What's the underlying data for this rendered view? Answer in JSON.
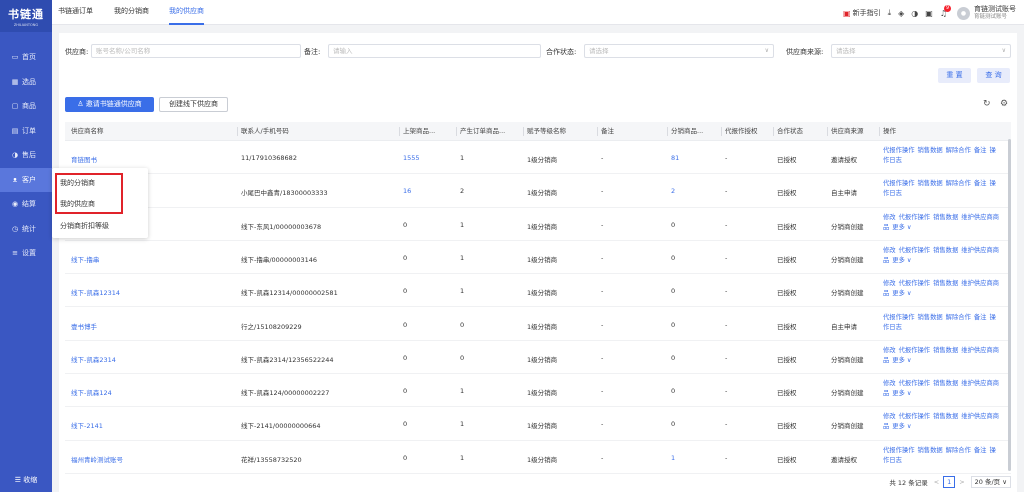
{
  "app": {
    "logo": "书链通",
    "logo_sub": "ZHILIANTONG"
  },
  "sidebar": {
    "items": [
      {
        "label": "首页",
        "icon": "monitor-icon",
        "glyph": "▭"
      },
      {
        "label": "选品",
        "icon": "grid-icon",
        "glyph": "▦"
      },
      {
        "label": "商品",
        "icon": "box-icon",
        "glyph": "▢"
      },
      {
        "label": "订单",
        "icon": "order-icon",
        "glyph": "▤"
      },
      {
        "label": "售后",
        "icon": "headset-icon",
        "glyph": "◑"
      },
      {
        "label": "客户",
        "icon": "users-icon",
        "glyph": "ᴥ"
      },
      {
        "label": "结算",
        "icon": "settle-icon",
        "glyph": "◉"
      },
      {
        "label": "统计",
        "icon": "clock-icon",
        "glyph": "◷"
      },
      {
        "label": "设置",
        "icon": "settings-icon",
        "glyph": "≡"
      }
    ],
    "collapse": "☰ 收缩"
  },
  "topnav": {
    "tabs": [
      "书链通订单",
      "我的分销商",
      "我的供应商"
    ],
    "guide": "新手指引",
    "user_name": "育链测试账号",
    "user_sub": "育链测试账号",
    "badge": "9"
  },
  "popup": {
    "items": [
      "我的分销商",
      "我的供应商",
      "分销商折扣等级"
    ]
  },
  "filters": {
    "supplier_label": "供应商:",
    "supplier_ph": "账号名称/公司名称",
    "remark_label": "备注:",
    "remark_ph": "请输入",
    "status_label": "合作状态:",
    "status_ph": "请选择",
    "source_label": "供应商来源:",
    "source_ph": "请选择",
    "reset": "重 置",
    "query": "查 询"
  },
  "actions": {
    "invite": "邀请书链通供应商",
    "create": "创建线下供应商"
  },
  "table": {
    "headers": [
      "供应商名称",
      "联系人/手机号码",
      "上架商品...",
      "产生订单商品...",
      "赋予等级名称",
      "备注",
      "分销商品...",
      "代报作授权",
      "合作状态",
      "供应商来源",
      "操作"
    ],
    "rows": [
      {
        "name": "育链图书",
        "contact": "11/17910368682",
        "listed": "1555",
        "ordered": "1",
        "level": "1级分销商",
        "remark": "-",
        "dist": "81",
        "auth": "-",
        "status": "已授权",
        "source": "邀请授权",
        "ops": [
          "代报作操作",
          "销售数据",
          "解除合作",
          "备注",
          "操作日志"
        ]
      },
      {
        "name": "",
        "contact": "小尾巴中鑫青/18300003333",
        "listed": "16",
        "ordered": "2",
        "level": "1级分销商",
        "remark": "-",
        "dist": "2",
        "auth": "-",
        "status": "已授权",
        "source": "自主申请",
        "ops": [
          "代报作操作",
          "销售数据",
          "解除合作",
          "备注",
          "操作日志"
        ]
      },
      {
        "name": "",
        "contact": "线下-东风1/00000003678",
        "listed": "0",
        "ordered": "1",
        "level": "1级分销商",
        "remark": "-",
        "dist": "0",
        "auth": "-",
        "status": "已授权",
        "source": "分销商创建",
        "ops": [
          "修改",
          "代报作操作",
          "销售数据",
          "维护供应商商品",
          "更多 ∨"
        ]
      },
      {
        "name": "线下-撸串",
        "contact": "线下-撸串/00000003146",
        "listed": "0",
        "ordered": "1",
        "level": "1级分销商",
        "remark": "-",
        "dist": "0",
        "auth": "-",
        "status": "已授权",
        "source": "分销商创建",
        "ops": [
          "修改",
          "代报作操作",
          "销售数据",
          "维护供应商商品",
          "更多 ∨"
        ]
      },
      {
        "name": "线下-凯森12314",
        "contact": "线下-凯森12314/00000002581",
        "listed": "0",
        "ordered": "1",
        "level": "1级分销商",
        "remark": "-",
        "dist": "0",
        "auth": "-",
        "status": "已授权",
        "source": "分销商创建",
        "ops": [
          "修改",
          "代报作操作",
          "销售数据",
          "维护供应商商品",
          "更多 ∨"
        ]
      },
      {
        "name": "壹书博手",
        "contact": "行之/15108209229",
        "listed": "0",
        "ordered": "0",
        "level": "1级分销商",
        "remark": "-",
        "dist": "0",
        "auth": "-",
        "status": "已授权",
        "source": "自主申请",
        "ops": [
          "代报作操作",
          "销售数据",
          "解除合作",
          "备注",
          "操作日志"
        ]
      },
      {
        "name": "线下-凯森2314",
        "contact": "线下-凯森2314/12356522244",
        "listed": "0",
        "ordered": "0",
        "level": "1级分销商",
        "remark": "-",
        "dist": "0",
        "auth": "-",
        "status": "已授权",
        "source": "分销商创建",
        "ops": [
          "修改",
          "代报作操作",
          "销售数据",
          "维护供应商商品",
          "更多 ∨"
        ]
      },
      {
        "name": "线下-凯森124",
        "contact": "线下-凯森124/00000002227",
        "listed": "0",
        "ordered": "1",
        "level": "1级分销商",
        "remark": "-",
        "dist": "0",
        "auth": "-",
        "status": "已授权",
        "source": "分销商创建",
        "ops": [
          "修改",
          "代报作操作",
          "销售数据",
          "维护供应商商品",
          "更多 ∨"
        ]
      },
      {
        "name": "线下-2141",
        "contact": "线下-2141/00000000664",
        "listed": "0",
        "ordered": "1",
        "level": "1级分销商",
        "remark": "-",
        "dist": "0",
        "auth": "-",
        "status": "已授权",
        "source": "分销商创建",
        "ops": [
          "修改",
          "代报作操作",
          "销售数据",
          "维护供应商商品",
          "更多 ∨"
        ]
      },
      {
        "name": "福州青岭测试账号",
        "contact": "花祥/13558732520",
        "listed": "0",
        "ordered": "1",
        "level": "1级分销商",
        "remark": "-",
        "dist": "1",
        "auth": "-",
        "status": "已授权",
        "source": "邀请授权",
        "ops": [
          "代报作操作",
          "销售数据",
          "解除合作",
          "备注",
          "操作日志"
        ]
      }
    ]
  },
  "pagination": {
    "total": "共 12 条记录",
    "page": "1",
    "size": "20 条/页 ∨"
  }
}
